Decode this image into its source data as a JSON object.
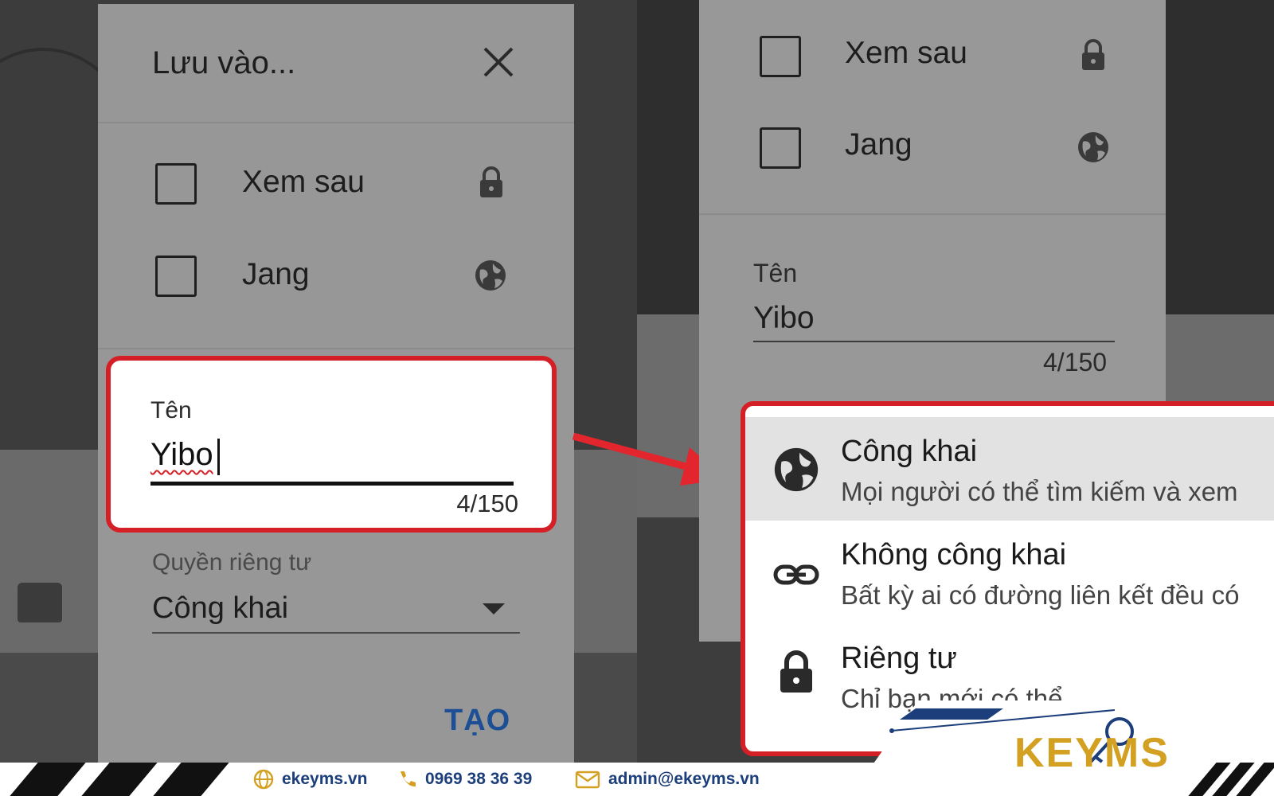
{
  "left_dialog": {
    "title": "Lưu vào...",
    "playlists": [
      {
        "label": "Xem sau",
        "icon": "lock-icon"
      },
      {
        "label": "Jang",
        "icon": "globe-icon"
      }
    ],
    "name_field": {
      "label": "Tên",
      "value": "Yibo",
      "counter": "4/150"
    },
    "privacy": {
      "label": "Quyền riêng tư",
      "value": "Công khai"
    },
    "create_button": "TẠO"
  },
  "right_dialog": {
    "playlists": [
      {
        "label": "Xem sau",
        "icon": "lock-icon"
      },
      {
        "label": "Jang",
        "icon": "globe-icon"
      }
    ],
    "name_field": {
      "label": "Tên",
      "value": "Yibo",
      "counter": "4/150"
    },
    "privacy_menu": [
      {
        "title": "Công khai",
        "subtitle": "Mọi người có thể tìm kiếm và xem",
        "icon": "globe-icon",
        "selected": true
      },
      {
        "title": "Không công khai",
        "subtitle": "Bất kỳ ai có đường liên kết đều có",
        "icon": "link-icon",
        "selected": false
      },
      {
        "title": "Riêng tư",
        "subtitle": "Chỉ bạn mới có thể",
        "icon": "lock-icon",
        "selected": false
      }
    ]
  },
  "footer": {
    "website": "ekeyms.vn",
    "phone": "0969 38 36 39",
    "email": "admin@ekeyms.vn",
    "logo": "KEYMS"
  },
  "colors": {
    "highlight": "#d41f26",
    "accent_blue": "#1c4f95",
    "brand_gold": "#d3a021",
    "brand_navy": "#1c3e7a"
  }
}
